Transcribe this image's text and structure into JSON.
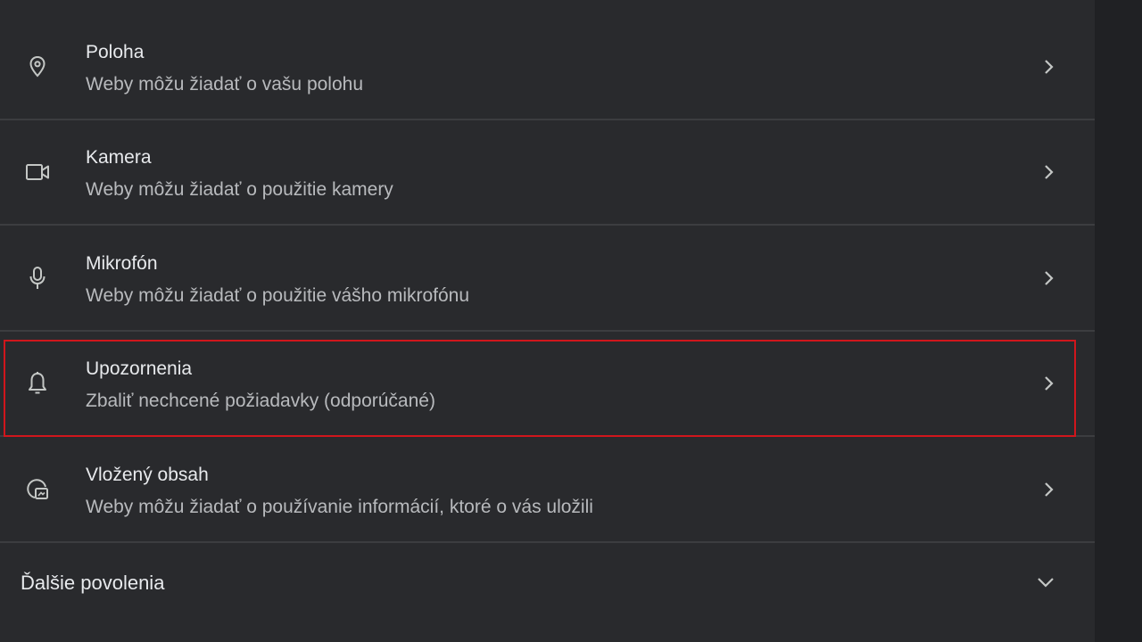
{
  "permissions": [
    {
      "title": "Poloha",
      "subtitle": "Weby môžu žiadať o vašu polohu",
      "icon": "location-pin-icon"
    },
    {
      "title": "Kamera",
      "subtitle": "Weby môžu žiadať o použitie kamery",
      "icon": "camera-icon"
    },
    {
      "title": "Mikrofón",
      "subtitle": "Weby môžu žiadať o použitie vášho mikrofónu",
      "icon": "microphone-icon"
    },
    {
      "title": "Upozornenia",
      "subtitle": "Zbaliť nechcené požiadavky (odporúčané)",
      "icon": "bell-icon"
    },
    {
      "title": "Vložený obsah",
      "subtitle": "Weby môžu žiadať o používanie informácií, ktoré o vás uložili",
      "icon": "embedded-content-icon"
    }
  ],
  "more_permissions": {
    "label": "Ďalšie povolenia",
    "icon": "chevron-down-icon"
  },
  "colors": {
    "background": "#292a2d",
    "title_text": "#e8eaed",
    "subtitle_text": "#b8babd",
    "icon": "#c4c7c5",
    "highlight": "#d0161c"
  }
}
